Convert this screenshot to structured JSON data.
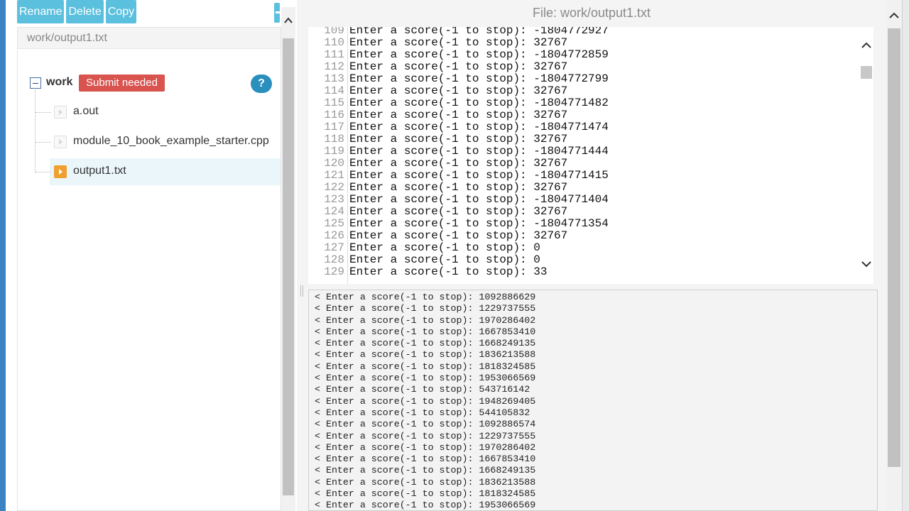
{
  "toolbar": {
    "buttons": [
      "Rename",
      "Delete",
      "Copy"
    ]
  },
  "file_tree": {
    "path": "work/output1.txt",
    "root": {
      "label": "work",
      "badge": "Submit needed",
      "help": "?"
    },
    "files": [
      {
        "name": "a.out",
        "selected": false
      },
      {
        "name": "module_10_book_example_starter.cpp",
        "selected": false
      },
      {
        "name": "output1.txt",
        "selected": true
      }
    ]
  },
  "editor": {
    "title": "File: work/output1.txt",
    "lines": [
      {
        "n": "109",
        "text": "Enter a score(-1 to stop): -1804772927"
      },
      {
        "n": "110",
        "text": "Enter a score(-1 to stop): 32767"
      },
      {
        "n": "111",
        "text": "Enter a score(-1 to stop): -1804772859"
      },
      {
        "n": "112",
        "text": "Enter a score(-1 to stop): 32767"
      },
      {
        "n": "113",
        "text": "Enter a score(-1 to stop): -1804772799"
      },
      {
        "n": "114",
        "text": "Enter a score(-1 to stop): 32767"
      },
      {
        "n": "115",
        "text": "Enter a score(-1 to stop): -1804771482"
      },
      {
        "n": "116",
        "text": "Enter a score(-1 to stop): 32767"
      },
      {
        "n": "117",
        "text": "Enter a score(-1 to stop): -1804771474"
      },
      {
        "n": "118",
        "text": "Enter a score(-1 to stop): 32767"
      },
      {
        "n": "119",
        "text": "Enter a score(-1 to stop): -1804771444"
      },
      {
        "n": "120",
        "text": "Enter a score(-1 to stop): 32767"
      },
      {
        "n": "121",
        "text": "Enter a score(-1 to stop): -1804771415"
      },
      {
        "n": "122",
        "text": "Enter a score(-1 to stop): 32767"
      },
      {
        "n": "123",
        "text": "Enter a score(-1 to stop): -1804771404"
      },
      {
        "n": "124",
        "text": "Enter a score(-1 to stop): 32767"
      },
      {
        "n": "125",
        "text": "Enter a score(-1 to stop): -1804771354"
      },
      {
        "n": "126",
        "text": "Enter a score(-1 to stop): 32767"
      },
      {
        "n": "127",
        "text": "Enter a score(-1 to stop): 0"
      },
      {
        "n": "128",
        "text": "Enter a score(-1 to stop): 0"
      },
      {
        "n": "129",
        "text": "Enter a score(-1 to stop): 33"
      }
    ]
  },
  "terminal": {
    "lines": [
      "< Enter a score(-1 to stop): 1092886629",
      "< Enter a score(-1 to stop): 1229737555",
      "< Enter a score(-1 to stop): 1970286402",
      "< Enter a score(-1 to stop): 1667853410",
      "< Enter a score(-1 to stop): 1668249135",
      "< Enter a score(-1 to stop): 1836213588",
      "< Enter a score(-1 to stop): 1818324585",
      "< Enter a score(-1 to stop): 1953066569",
      "< Enter a score(-1 to stop): 543716142",
      "< Enter a score(-1 to stop): 1948269405",
      "< Enter a score(-1 to stop): 544105832",
      "< Enter a score(-1 to stop): 1092886574",
      "< Enter a score(-1 to stop): 1229737555",
      "< Enter a score(-1 to stop): 1970286402",
      "< Enter a score(-1 to stop): 1667853410",
      "< Enter a score(-1 to stop): 1668249135",
      "< Enter a score(-1 to stop): 1836213588",
      "< Enter a score(-1 to stop): 1818324585",
      "< Enter a score(-1 to stop): 1953066569"
    ]
  },
  "colors": {
    "toolbar_button": "#5bc0de",
    "badge": "#d9534f",
    "help": "#2a8fbd",
    "selected_file_icon": "#f0a030"
  },
  "icons": [
    "minus-icon",
    "file-icon",
    "help-icon",
    "chevron-up-icon",
    "chevron-down-icon"
  ]
}
